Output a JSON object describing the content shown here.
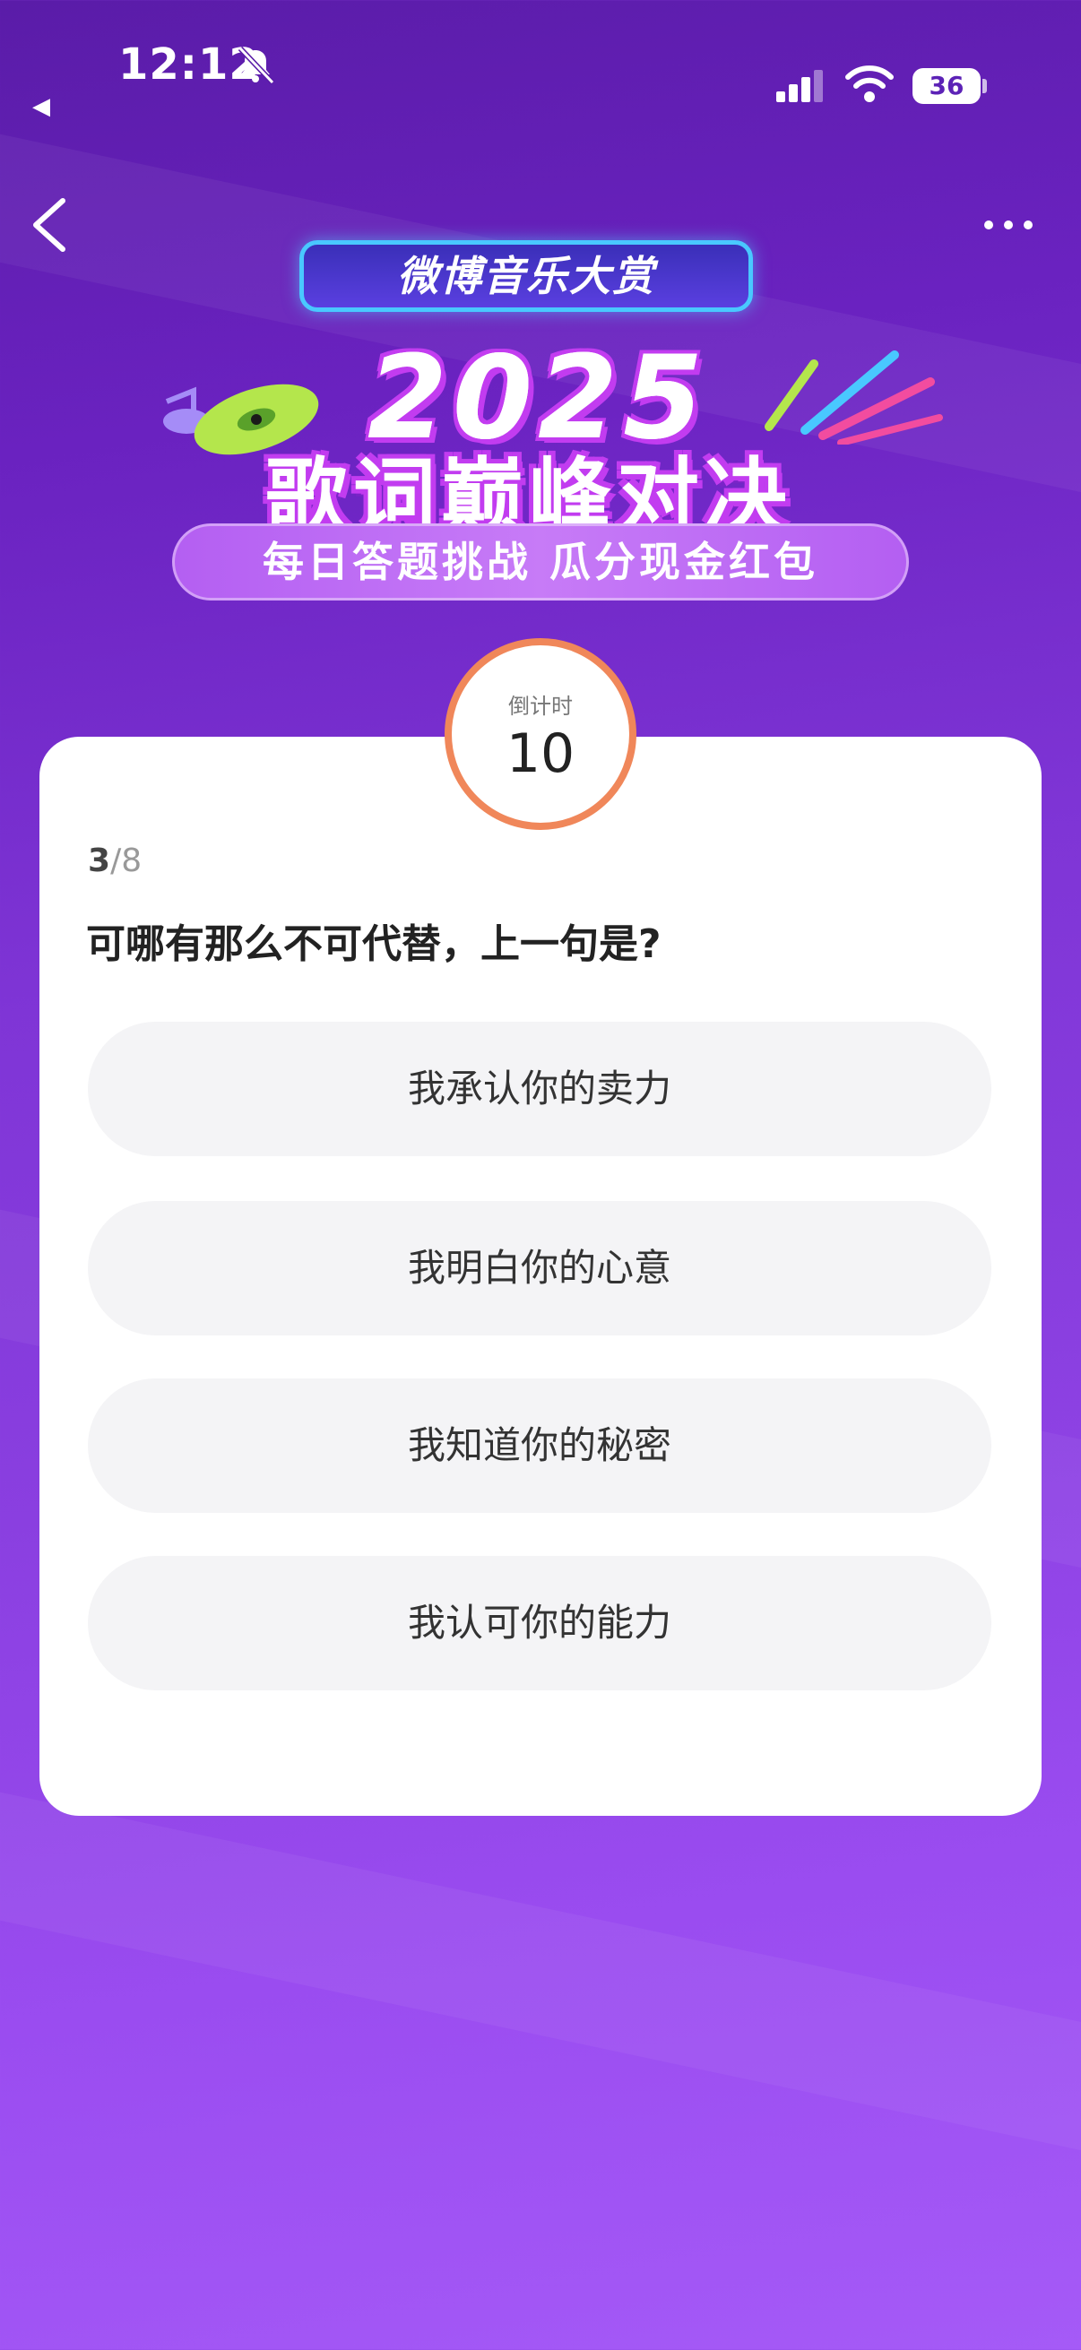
{
  "status_bar": {
    "time": "12:12",
    "battery": "36"
  },
  "banner": {
    "brand": "微博音乐大赏",
    "year": "2025",
    "headline": "歌词巅峰对决",
    "tagline": "每日答题挑战 瓜分现金红包"
  },
  "quiz": {
    "timer_label": "倒计时",
    "timer_value": "10",
    "progress_current": "3",
    "progress_total": "/8",
    "question": "可哪有那么不可代替，上一句是?",
    "options": [
      {
        "label": "我承认你的卖力"
      },
      {
        "label": "我明白你的心意"
      },
      {
        "label": "我知道你的秘密"
      },
      {
        "label": "我认可你的能力"
      }
    ]
  },
  "colors": {
    "accent": "#f0875a",
    "background": "#7f35d6",
    "option_bg": "#f4f4f6"
  }
}
